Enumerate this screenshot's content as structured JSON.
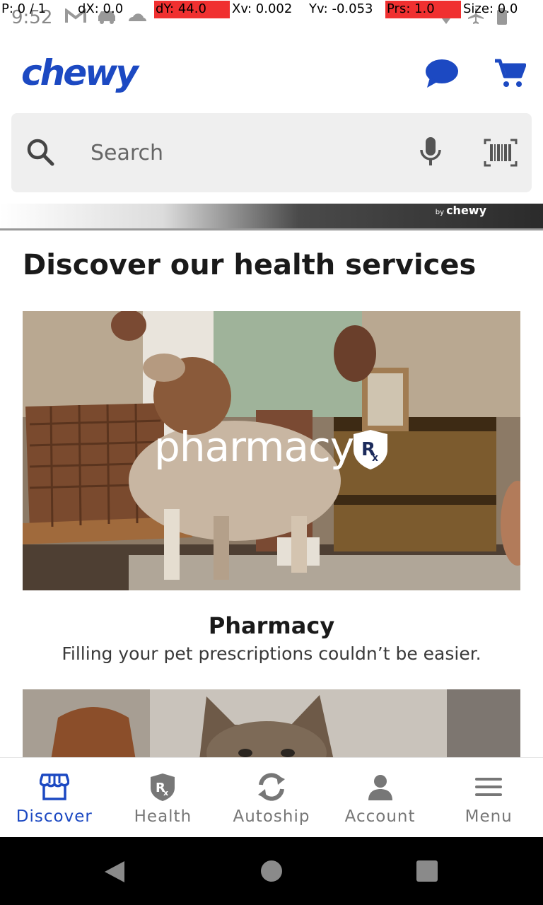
{
  "status_bar": {
    "time": "9:52",
    "debug": {
      "pointer": "P: 0 / 1",
      "dx": "dX: 0.0",
      "dy": "dY: 44.0",
      "xv": "Xv: 0.002",
      "yv": "Yv: -0.053",
      "prs": "Prs: 1.0",
      "size": "Size: 0.0"
    },
    "icons_left": [
      "gmail-icon",
      "car-icon",
      "cloud-icon"
    ],
    "icons_right": [
      "wifi-icon",
      "airplane-icon",
      "battery-icon"
    ]
  },
  "header": {
    "logo_text": "chewy",
    "chat_icon": "chat-bubble-icon",
    "cart_icon": "cart-icon"
  },
  "search": {
    "placeholder": "Search",
    "icons": [
      "search-icon",
      "mic-icon",
      "barcode-icon"
    ]
  },
  "banner": {
    "by_label": "by",
    "brand": "chewy"
  },
  "main": {
    "section_title": "Discover our health services",
    "cards": [
      {
        "image_overlay_text": "pharmacy",
        "image_badge": "Rx",
        "title": "Pharmacy",
        "description": "Filling your pet prescriptions couldn’t be easier."
      }
    ]
  },
  "bottom_nav": {
    "items": [
      {
        "label": "Discover",
        "icon": "storefront-icon",
        "active": true
      },
      {
        "label": "Health",
        "icon": "rx-shield-icon",
        "active": false
      },
      {
        "label": "Autoship",
        "icon": "autoship-refresh-icon",
        "active": false
      },
      {
        "label": "Account",
        "icon": "person-icon",
        "active": false
      },
      {
        "label": "Menu",
        "icon": "hamburger-menu-icon",
        "active": false
      }
    ]
  },
  "colors": {
    "brand_blue": "#1c49c2",
    "nav_inactive": "#777777",
    "debug_red": "#f03030"
  }
}
